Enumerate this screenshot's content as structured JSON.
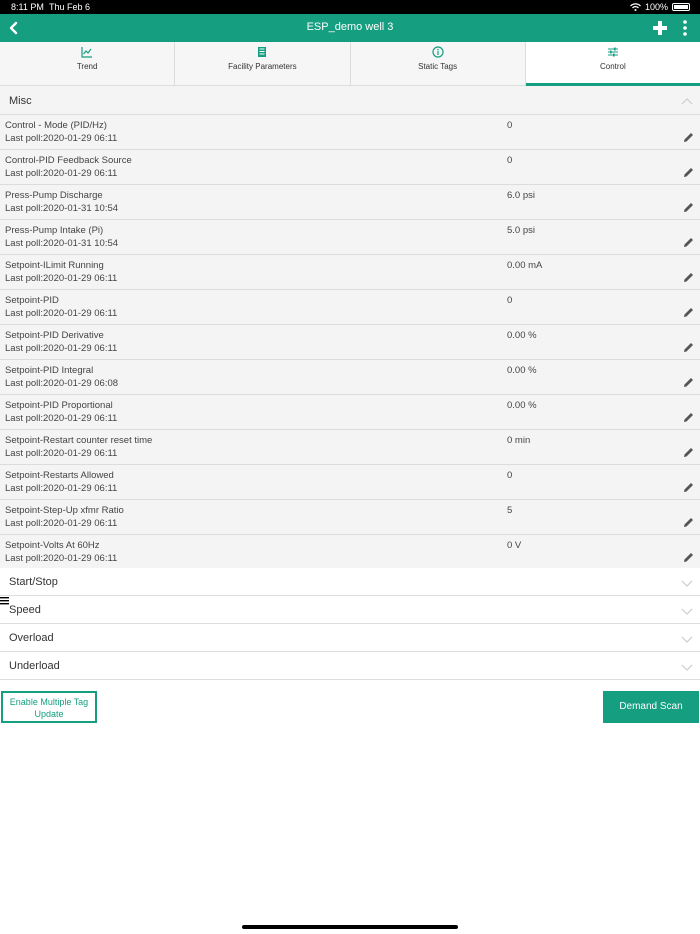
{
  "status_bar": {
    "time": "8:11 PM",
    "date": "Thu Feb 6",
    "battery": "100%"
  },
  "header": {
    "title": "ESP_demo well 3",
    "back_icon": "chevron-left-icon",
    "add_icon": "plus-icon",
    "menu_icon": "kebab-menu-icon"
  },
  "tabs": [
    {
      "label": "Trend",
      "icon": "line-chart-icon"
    },
    {
      "label": "Facility Parameters",
      "icon": "book-icon"
    },
    {
      "label": "Static Tags",
      "icon": "info-icon"
    },
    {
      "label": "Control",
      "icon": "sliders-icon",
      "active": true
    }
  ],
  "misc_section": {
    "title": "Misc",
    "rows": [
      {
        "name": "Control - Mode (PID/Hz)",
        "poll": "Last poll:2020-01-29 06:11",
        "value": "0"
      },
      {
        "name": "Control-PID Feedback Source",
        "poll": "Last poll:2020-01-29 06:11",
        "value": "0"
      },
      {
        "name": "Press-Pump Discharge",
        "poll": "Last poll:2020-01-31 10:54",
        "value": "6.0 psi"
      },
      {
        "name": "Press-Pump Intake (Pi)",
        "poll": "Last poll:2020-01-31 10:54",
        "value": "5.0 psi"
      },
      {
        "name": "Setpoint-ILimit Running",
        "poll": "Last poll:2020-01-29 06:11",
        "value": "0.00 mA"
      },
      {
        "name": "Setpoint-PID",
        "poll": "Last poll:2020-01-29 06:11",
        "value": "0"
      },
      {
        "name": "Setpoint-PID Derivative",
        "poll": "Last poll:2020-01-29 06:11",
        "value": "0.00 %"
      },
      {
        "name": "Setpoint-PID Integral",
        "poll": "Last poll:2020-01-29 06:08",
        "value": "0.00 %"
      },
      {
        "name": "Setpoint-PID Proportional",
        "poll": "Last poll:2020-01-29 06:11",
        "value": "0.00 %"
      },
      {
        "name": "Setpoint-Restart counter reset time",
        "poll": "Last poll:2020-01-29 06:11",
        "value": "0 min"
      },
      {
        "name": "Setpoint-Restarts Allowed",
        "poll": "Last poll:2020-01-29 06:11",
        "value": "0"
      },
      {
        "name": "Setpoint-Step-Up xfmr Ratio",
        "poll": "Last poll:2020-01-29 06:11",
        "value": "5"
      },
      {
        "name": "Setpoint-Volts At 60Hz",
        "poll": "Last poll:2020-01-29 06:11",
        "value": "0 V"
      }
    ]
  },
  "collapsed_sections": [
    {
      "title": "Start/Stop"
    },
    {
      "title": "Speed"
    },
    {
      "title": "Overload"
    },
    {
      "title": "Underload"
    }
  ],
  "buttons": {
    "enable_multiple": "Enable Multiple Tag Update",
    "demand_scan": "Demand Scan"
  },
  "colors": {
    "accent": "#159e7f",
    "row_bg": "#f4f4f4"
  }
}
